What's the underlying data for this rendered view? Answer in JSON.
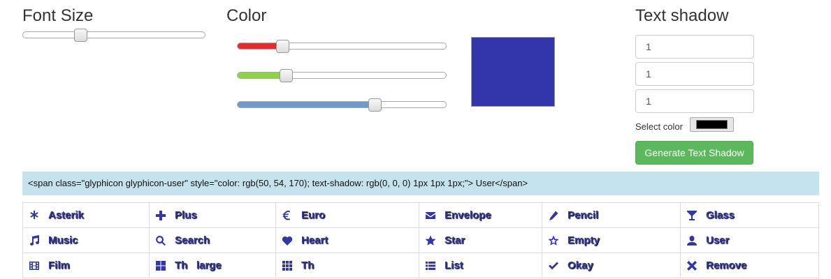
{
  "font_size": {
    "title": "Font Size",
    "value_fraction": 0.3
  },
  "color": {
    "title": "Color",
    "red_value": 50,
    "green_value": 54,
    "blue_value": 170,
    "red_fill": "#e52b2b",
    "green_fill": "#88d640",
    "blue_fill": "#6d9ccc",
    "preview": "#3236aa"
  },
  "text_shadow": {
    "title": "Text shadow",
    "inputs": [
      "1",
      "1",
      "1"
    ],
    "select_color_label": "Select color",
    "select_color_value": "#000000",
    "generate_label": "Generate Text Shadow"
  },
  "code_output": "<span class=\"glyphicon glyphicon-user\" style=\"color: rgb(50, 54, 170); text-shadow: rgb(0, 0, 0) 1px 1px 1px;\"> User</span>",
  "icons": [
    [
      {
        "label": "Asterik",
        "icon": "asterisk-icon"
      },
      {
        "label": "Plus",
        "icon": "plus-icon"
      },
      {
        "label": "Euro",
        "icon": "euro-icon"
      },
      {
        "label": "Envelope",
        "icon": "envelope-icon"
      },
      {
        "label": "Pencil",
        "icon": "pencil-icon"
      },
      {
        "label": "Glass",
        "icon": "glass-icon"
      }
    ],
    [
      {
        "label": "Music",
        "icon": "music-icon"
      },
      {
        "label": "Search",
        "icon": "search-icon"
      },
      {
        "label": "Heart",
        "icon": "heart-icon"
      },
      {
        "label": "Star",
        "icon": "star-icon"
      },
      {
        "label": "Empty",
        "icon": "star-empty-icon"
      },
      {
        "label": "User",
        "icon": "user-icon"
      }
    ],
    [
      {
        "label": "Film",
        "icon": "film-icon"
      },
      {
        "label": "Th   large",
        "icon": "th-large-icon"
      },
      {
        "label": "Th",
        "icon": "th-icon"
      },
      {
        "label": "List",
        "icon": "list-icon"
      },
      {
        "label": "Okay",
        "icon": "ok-icon"
      },
      {
        "label": "Remove",
        "icon": "remove-icon"
      }
    ]
  ]
}
